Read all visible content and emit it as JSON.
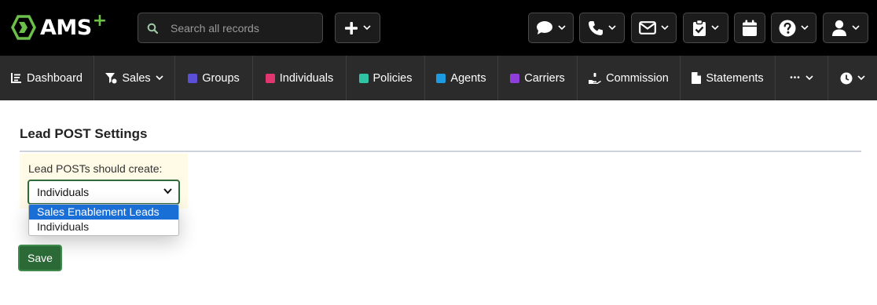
{
  "header": {
    "logo_text": "AMS",
    "logo_plus": "+",
    "search_placeholder": "Search all records",
    "buttons": [
      {
        "name": "add-new-button",
        "icon": "plus-icon"
      },
      {
        "name": "messages-button",
        "icon": "chat-bubble-icon"
      },
      {
        "name": "phone-button",
        "icon": "phone-icon"
      },
      {
        "name": "email-button",
        "icon": "envelope-icon"
      },
      {
        "name": "tasks-button",
        "icon": "clipboard-check-icon"
      },
      {
        "name": "calendar-button",
        "icon": "calendar-icon"
      },
      {
        "name": "help-button",
        "icon": "question-circle-icon"
      },
      {
        "name": "user-menu-button",
        "icon": "user-icon"
      }
    ]
  },
  "nav": {
    "items": [
      {
        "label": "Dashboard",
        "icon": "chart-line-icon"
      },
      {
        "label": "Sales",
        "icon": "filter-icon",
        "has_dropdown": true
      },
      {
        "label": "Groups",
        "color": "#5b4fd6"
      },
      {
        "label": "Individuals",
        "color": "#e0356e"
      },
      {
        "label": "Policies",
        "color": "#2ec4a5"
      },
      {
        "label": "Agents",
        "color": "#1e9be0"
      },
      {
        "label": "Carriers",
        "color": "#8e3fd9"
      },
      {
        "label": "Commission",
        "icon": "hand-money-icon"
      },
      {
        "label": "Statements",
        "icon": "file-icon"
      },
      {
        "label": "•••",
        "icon": "more-icon",
        "has_dropdown": true
      },
      {
        "label": "",
        "icon": "clock-icon",
        "has_dropdown": true
      }
    ]
  },
  "page": {
    "section_title": "Lead POST Settings",
    "field_label": "Lead POSTs should create:",
    "select_value": "Individuals",
    "options": [
      "Sales Enablement Leads",
      "Individuals"
    ],
    "highlighted_option": "Sales Enablement Leads",
    "save_label": "Save"
  },
  "colors": {
    "topbar": "#000000",
    "navbar": "#2b2b2b",
    "accent_green": "#2b6a36",
    "logo_green": "#6cc04a",
    "option_highlight": "#1a6fd6",
    "form_background": "#fffbe6"
  }
}
